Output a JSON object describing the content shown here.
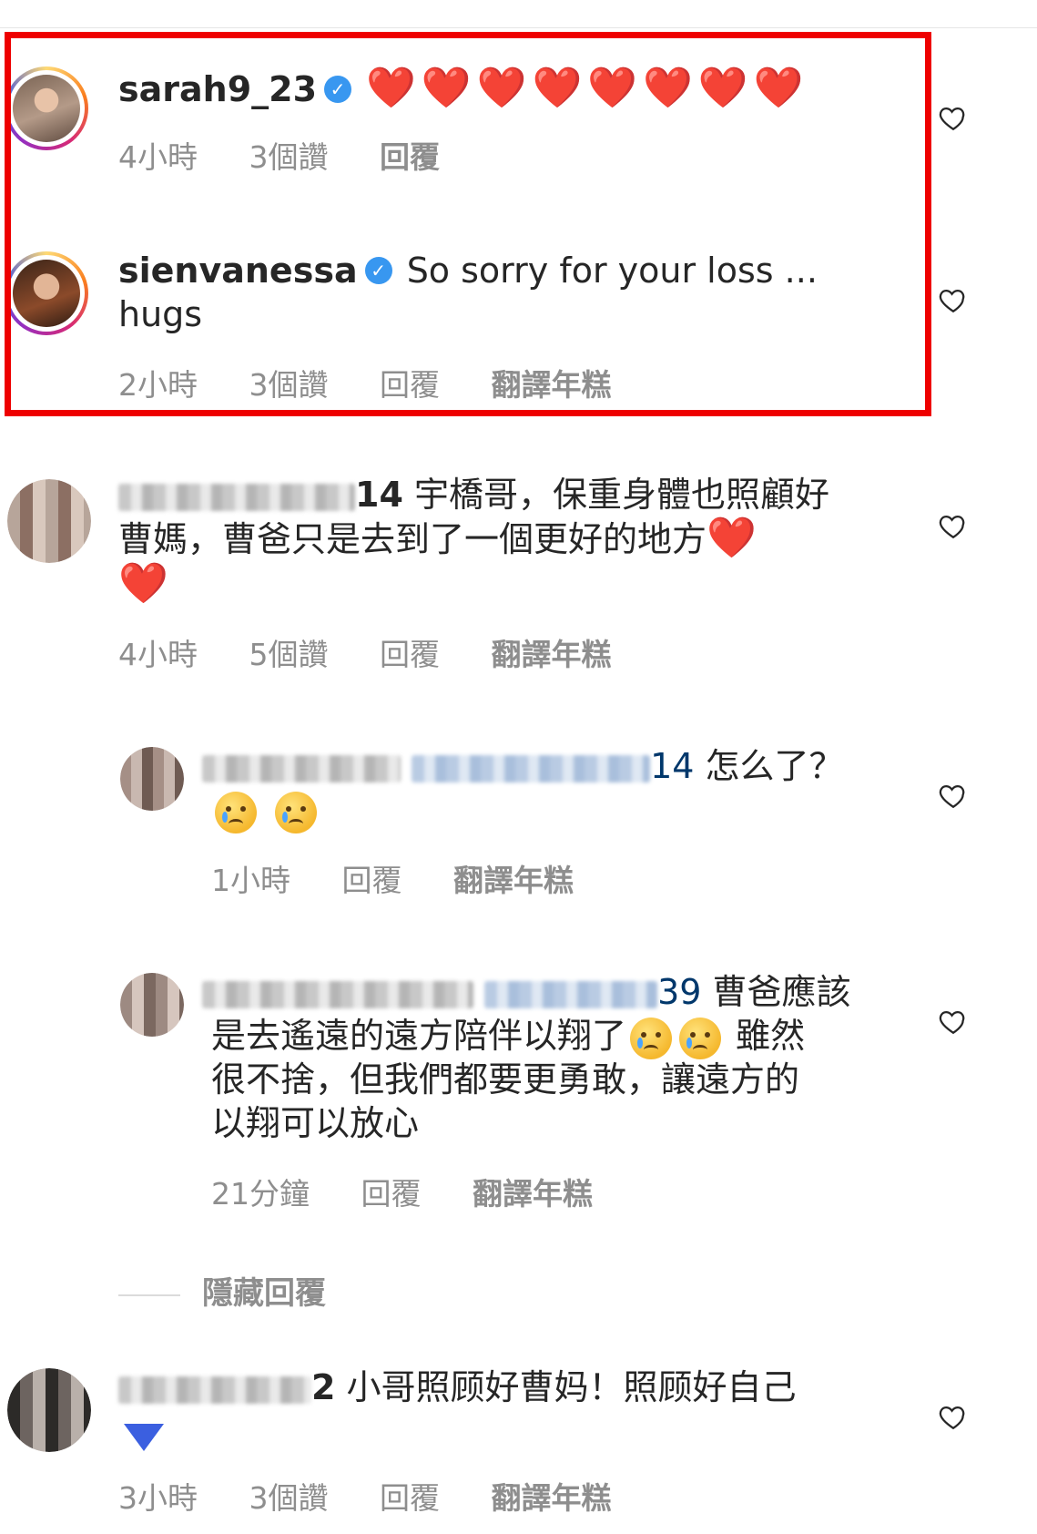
{
  "comments": [
    {
      "username": "sarah9_23",
      "verified": true,
      "text": "❤️❤️❤️❤️❤️❤️❤️❤️",
      "time": "4小時",
      "likes": "3個讚",
      "reply": "回覆"
    },
    {
      "username": "sienvanessa",
      "verified": true,
      "text": "So sorry for your loss ... ",
      "text2": "hugs",
      "time": "2小時",
      "likes": "3個讚",
      "reply": "回覆",
      "translate": "翻譯年糕"
    },
    {
      "username_visible_tail": "14",
      "text": "宇橋哥，保重身體也照顧好",
      "text2": "曹媽，曹爸只是去到了一個更好的地方",
      "time": "4小時",
      "likes": "5個讚",
      "reply": "回覆",
      "translate": "翻譯年糕"
    },
    {
      "mention_visible_tail": "14",
      "text": "怎么了？",
      "time": "1小時",
      "reply": "回覆",
      "translate": "翻譯年糕"
    },
    {
      "mention_visible_tail": "39",
      "text": "曹爸應該",
      "text2": "是去遙遠的遠方陪伴以翔了",
      "text2b": "雖然",
      "text3": "很不捨，但我們都要更勇敢，讓遠方的",
      "text4": "以翔可以放心",
      "time": "21分鐘",
      "reply": "回覆",
      "translate": "翻譯年糕"
    },
    {
      "username_visible_tail": "2",
      "text": "小哥照顾好曹妈！照顾好自己",
      "time": "3小時",
      "likes": "3個讚",
      "reply": "回覆",
      "translate": "翻譯年糕"
    }
  ],
  "hidden_replies_label": "隱藏回覆",
  "highlight_color": "#ee0000",
  "icons": [
    "heart-outline-icon",
    "verified-badge-icon"
  ]
}
